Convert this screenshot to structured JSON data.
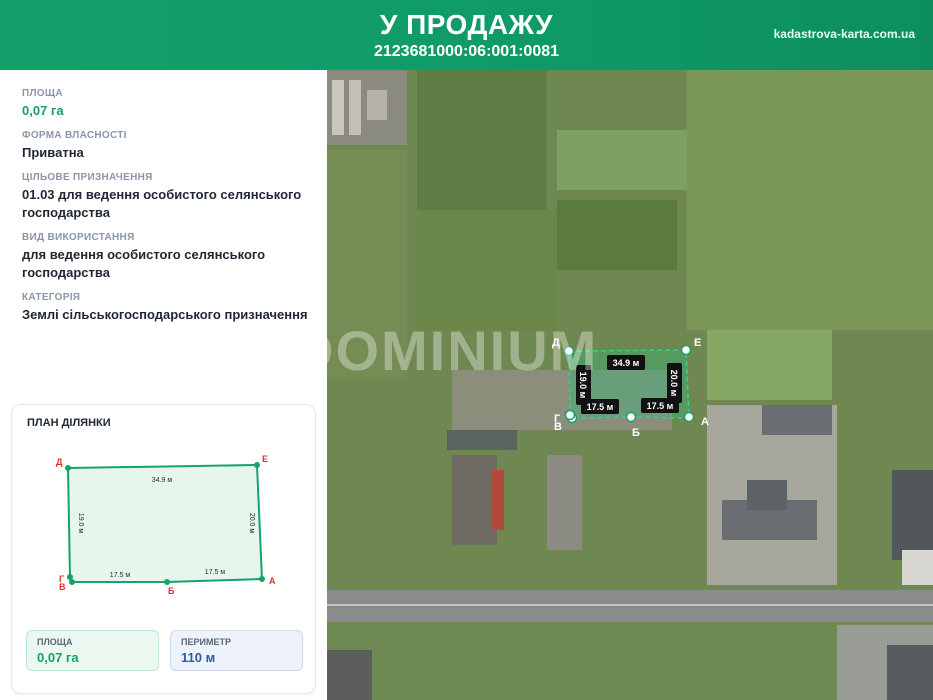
{
  "header": {
    "title": "У ПРОДАЖУ",
    "cadastral_number": "2123681000:06:001:0081",
    "site": "kadastrova-karta.com.ua"
  },
  "info": {
    "area_label": "ПЛОЩА",
    "area_value": "0,07 га",
    "ownership_label": "ФОРМА ВЛАСНОСТІ",
    "ownership_value": "Приватна",
    "purpose_label": "ЦІЛЬОВЕ ПРИЗНАЧЕННЯ",
    "purpose_value": "01.03 для ведення особистого селянського господарства",
    "usage_label": "ВИД ВИКОРИСТАННЯ",
    "usage_value": "для ведення особистого селянського господарства",
    "category_label": "КАТЕГОРІЯ",
    "category_value": "Землі сільськогосподарського призначення"
  },
  "plan": {
    "title": "ПЛАН ДІЛЯНКИ",
    "vertices": [
      "Д",
      "Е",
      "А",
      "Б",
      "В",
      "Г"
    ],
    "edges": {
      "top": "34.9 м",
      "left": "19.0 м",
      "right": "20.0 м",
      "bottom_left": "17.5 м",
      "bottom_right": "17.5 м"
    },
    "area_label": "ПЛОЩА",
    "area_value": "0,07 га",
    "perimeter_label": "ПЕРИМЕТР",
    "perimeter_value": "110 м"
  },
  "map": {
    "watermark": "DOMINIUM",
    "vertices": [
      "Д",
      "Е",
      "А",
      "Б",
      "В",
      "Г"
    ],
    "edges": {
      "top": "34.9 м",
      "left": "19.0 м",
      "right": "20.0 м",
      "bottom_left": "17.5 м",
      "bottom_right": "17.5 м"
    }
  },
  "colors": {
    "brand_green": "#14a06a",
    "vertex_label_red": "#d9342b",
    "perimeter_blue": "#2f59a8"
  }
}
